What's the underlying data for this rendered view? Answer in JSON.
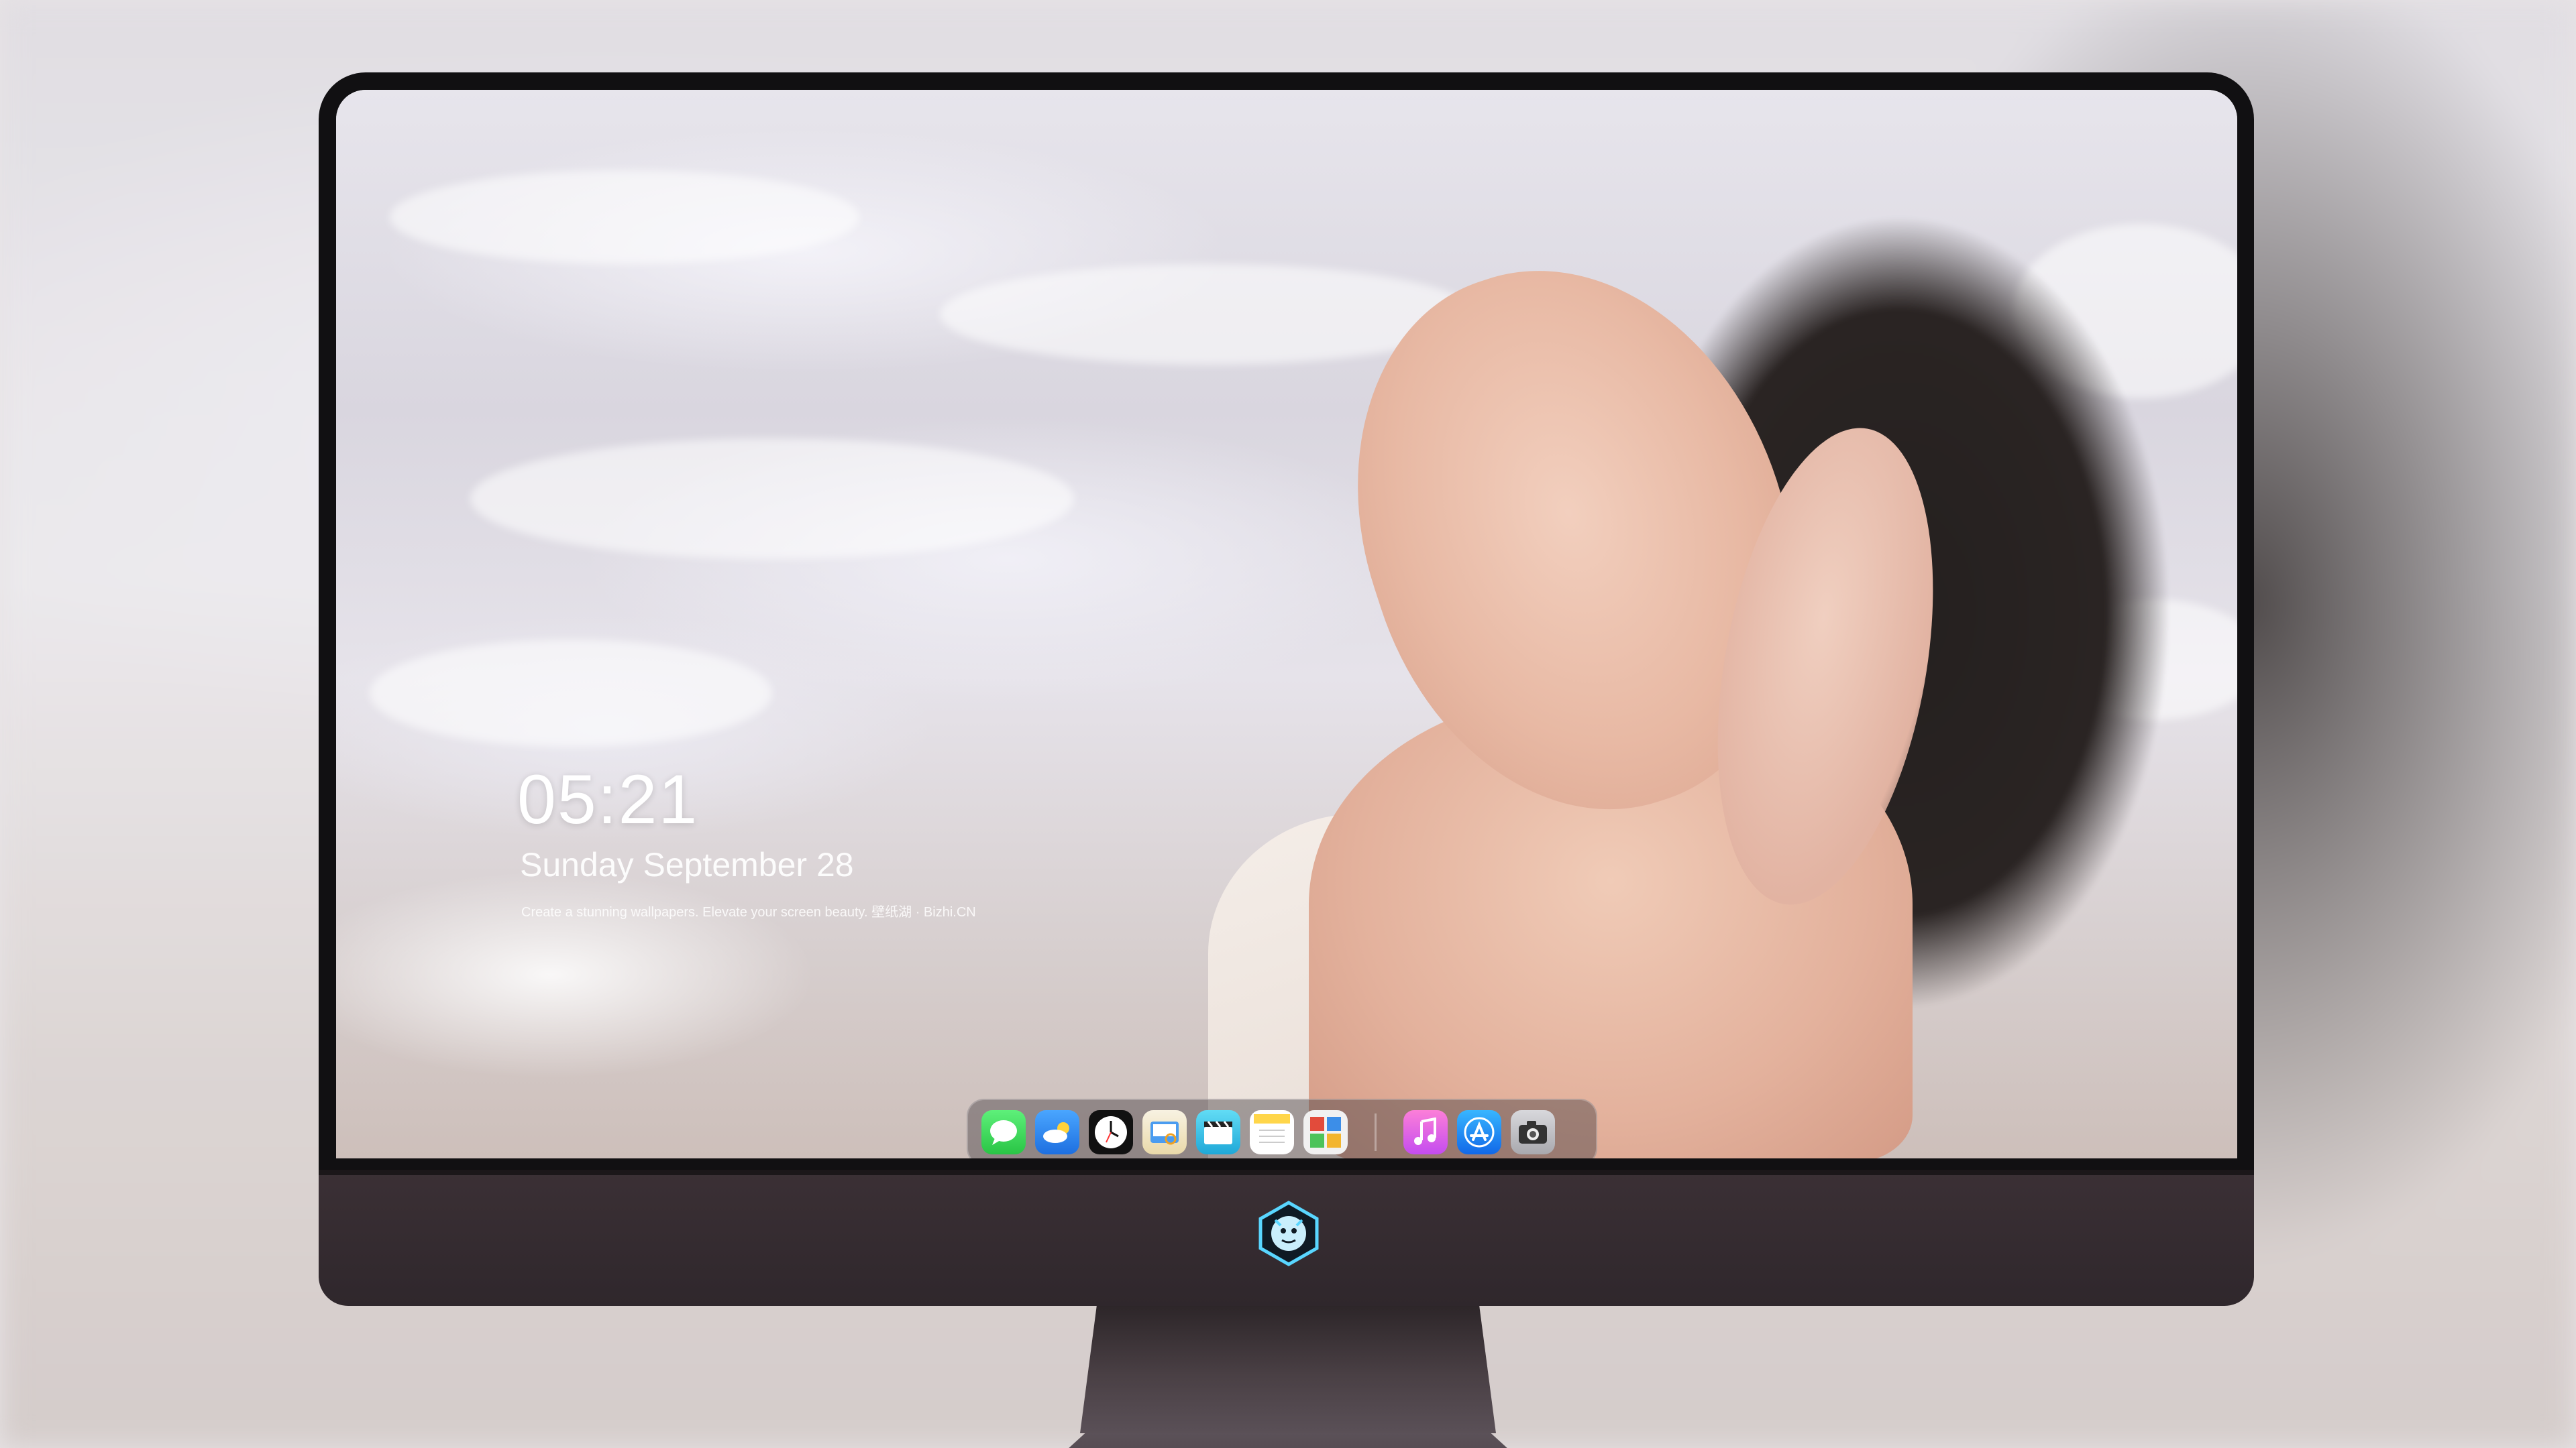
{
  "lockscreen": {
    "time": "05:21",
    "date": "Sunday  September  28",
    "tagline": "Create a stunning wallpapers. Elevate your screen beauty. 壁纸湖 · Bizhi.CN"
  },
  "dock": {
    "apps": [
      {
        "name": "Messages",
        "icon": "message-bubble-icon",
        "color": "#34c759"
      },
      {
        "name": "Weather",
        "icon": "weather-cloud-sun-icon",
        "color": "#2f8ff0"
      },
      {
        "name": "Clock",
        "icon": "clock-icon",
        "color": "#111111"
      },
      {
        "name": "Preview",
        "icon": "preview-icon",
        "color": "#f1c24a"
      },
      {
        "name": "Clips",
        "icon": "clapperboard-icon",
        "color": "#36c3e8"
      },
      {
        "name": "Notes",
        "icon": "notes-icon",
        "color": "#ffd64a"
      },
      {
        "name": "Photo Booth",
        "icon": "photo-grid-icon",
        "color": "#e24b3b"
      }
    ],
    "pinned": [
      {
        "name": "Music",
        "icon": "music-note-icon",
        "color": "#fb5bc5"
      },
      {
        "name": "App Store",
        "icon": "app-store-icon",
        "color": "#1d8cf8"
      },
      {
        "name": "Camera",
        "icon": "camera-icon",
        "color": "#3a3a3c"
      }
    ]
  },
  "brand": {
    "logo": "dragon-shield-logo",
    "logo_color": "#59d6ff"
  }
}
